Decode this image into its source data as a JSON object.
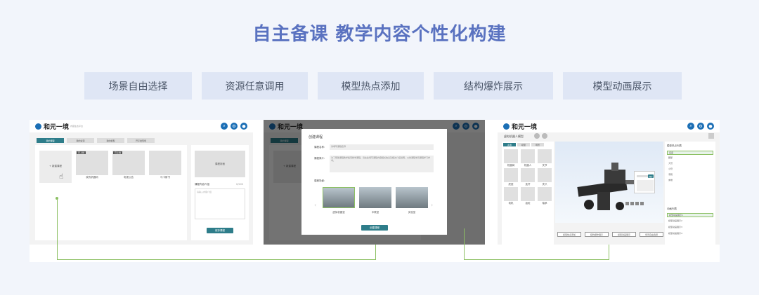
{
  "title": "自主备课  教学内容个性化构建",
  "features": [
    "场景自由选择",
    "资源任意调用",
    "模型热点添加",
    "结构爆炸展示",
    "模型动画展示"
  ],
  "app": {
    "logo_text": "和元一境",
    "logo_sub": "内容生态平台"
  },
  "shot1": {
    "tabs": [
      "我的课程",
      "我的资源",
      "我的模型",
      "开平发现场"
    ],
    "create_label": "+ 新建课程",
    "badges": [
      "已上线",
      "已上线"
    ],
    "cards": [
      "我的机器码",
      "电视公告",
      "马卡斯书"
    ],
    "preview_label": "课程封面",
    "intro_label": "课程内容介绍",
    "intro_count": "0/200",
    "intro_placeholder": "请输入内容介绍",
    "save_label": "保存课程"
  },
  "shot2": {
    "modal_title": "创建课程",
    "name_label": "课程名称:",
    "name_value": "请填写课程名称",
    "intro_label": "课程简介:",
    "intro_value": "为了帮助课程教学各项教学课程，请在此填写课程内容相关信息及相关介绍说明，以供课程学员课程学习参考。",
    "scene_label": "课程场景:",
    "scenes": [
      "虚拟机器室",
      "中教室",
      "实验室"
    ],
    "submit_label": "创建课程",
    "bg_tab": "我的课程",
    "bg_create": "+ 新建课程"
  },
  "shot3": {
    "left_title": "虚拟机器人模型",
    "left_tabs": [
      "资源",
      "模型",
      "场景"
    ],
    "grid_labels": [
      "机器臂",
      "机器人",
      "关节",
      "底座",
      "连杆",
      "夹爪",
      "电机",
      "齿轮",
      "轴承"
    ],
    "right_title": "模型热点列表",
    "list_items": [
      "底座",
      "腰部",
      "大臂",
      "小臂",
      "手腕",
      "末端"
    ],
    "anim_title": "动画列表",
    "anim_items": [
      "模型动画展示1",
      "模型动画展示2",
      "模型动画展示3",
      "模型动画展示4"
    ],
    "bottom_buttons": [
      "模型热点添加",
      "结构爆炸展示",
      "模型动画展示",
      "场景自由选择"
    ],
    "popup_btn": "确定"
  }
}
